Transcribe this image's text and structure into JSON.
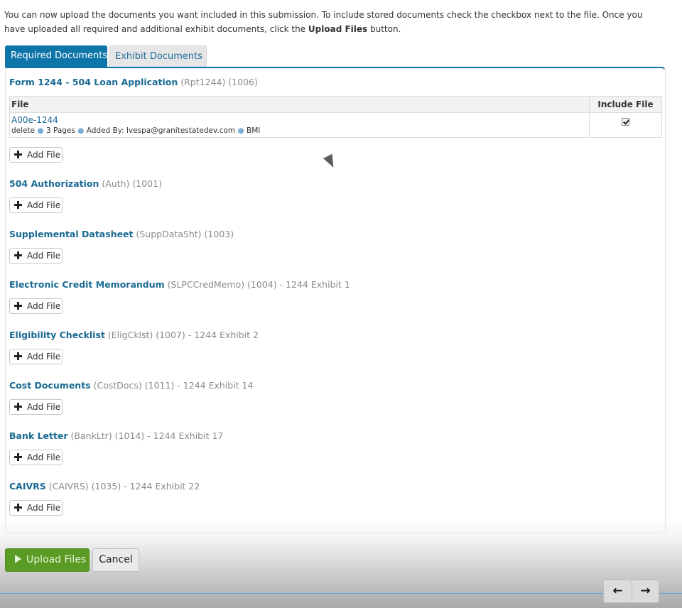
{
  "intro": {
    "text_before": "You can now upload the documents you want included in this submission. To include stored documents check the checkbox next to the file. Once you have uploaded all required and additional exhibit documents, click the ",
    "bold": "Upload Files",
    "text_after": " button."
  },
  "tabs": [
    {
      "label": "Required Documents",
      "active": true
    },
    {
      "label": "Exhibit Documents",
      "active": false
    }
  ],
  "table": {
    "col_file": "File",
    "col_include": "Include File",
    "rows": [
      {
        "file_name": "A00e-1244",
        "delete": "delete",
        "pages": "3 Pages",
        "added_by": "Added By: lvespa@granitestatedev.com",
        "org": "BMI",
        "include_checked": true
      }
    ]
  },
  "add_file_label": "Add File",
  "sections": [
    {
      "name": "Form 1244 - 504 Loan Application",
      "meta": " (Rpt1244) (1006)"
    },
    {
      "name": "504 Authorization",
      "meta": " (Auth) (1001)"
    },
    {
      "name": "Supplemental Datasheet",
      "meta": " (SuppDataSht) (1003)"
    },
    {
      "name": "Electronic Credit Memorandum",
      "meta": " (SLPCCredMemo) (1004) - 1244 Exhibit 1"
    },
    {
      "name": "Eligibility Checklist",
      "meta": " (EligCklst) (1007) - 1244 Exhibit 2"
    },
    {
      "name": "Cost Documents",
      "meta": " (CostDocs) (1011) - 1244 Exhibit 14"
    },
    {
      "name": "Bank Letter",
      "meta": " (BankLtr) (1014) - 1244 Exhibit 17"
    },
    {
      "name": "CAIVRS",
      "meta": " (CAIVRS) (1035) - 1244 Exhibit 22"
    }
  ],
  "actions": {
    "upload": "Upload Files",
    "cancel": "Cancel"
  },
  "nav": {
    "prev_icon": "arrow-left-icon",
    "next_icon": "arrow-right-icon"
  },
  "colors": {
    "accent": "#0e75a8",
    "link": "#1a6a93",
    "upload_green": "#5a9b23"
  }
}
